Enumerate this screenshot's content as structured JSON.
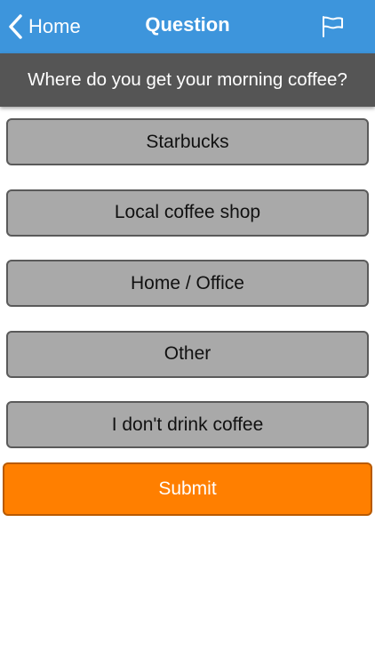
{
  "navbar": {
    "back_label": "Home",
    "title": "Question",
    "back_icon": "chevron-left-icon",
    "flag_icon": "flag-icon",
    "background_color": "#3d95dc"
  },
  "question": {
    "text": "Where do you get your morning coffee?",
    "background_color": "#555555"
  },
  "options": [
    {
      "label": "Starbucks"
    },
    {
      "label": "Local coffee shop"
    },
    {
      "label": "Home / Office"
    },
    {
      "label": "Other"
    },
    {
      "label": "I don't drink coffee"
    }
  ],
  "submit": {
    "label": "Submit",
    "color": "#ff7f00"
  },
  "colors": {
    "option_background": "#a9a9a9",
    "option_border": "#5a5a5a"
  }
}
